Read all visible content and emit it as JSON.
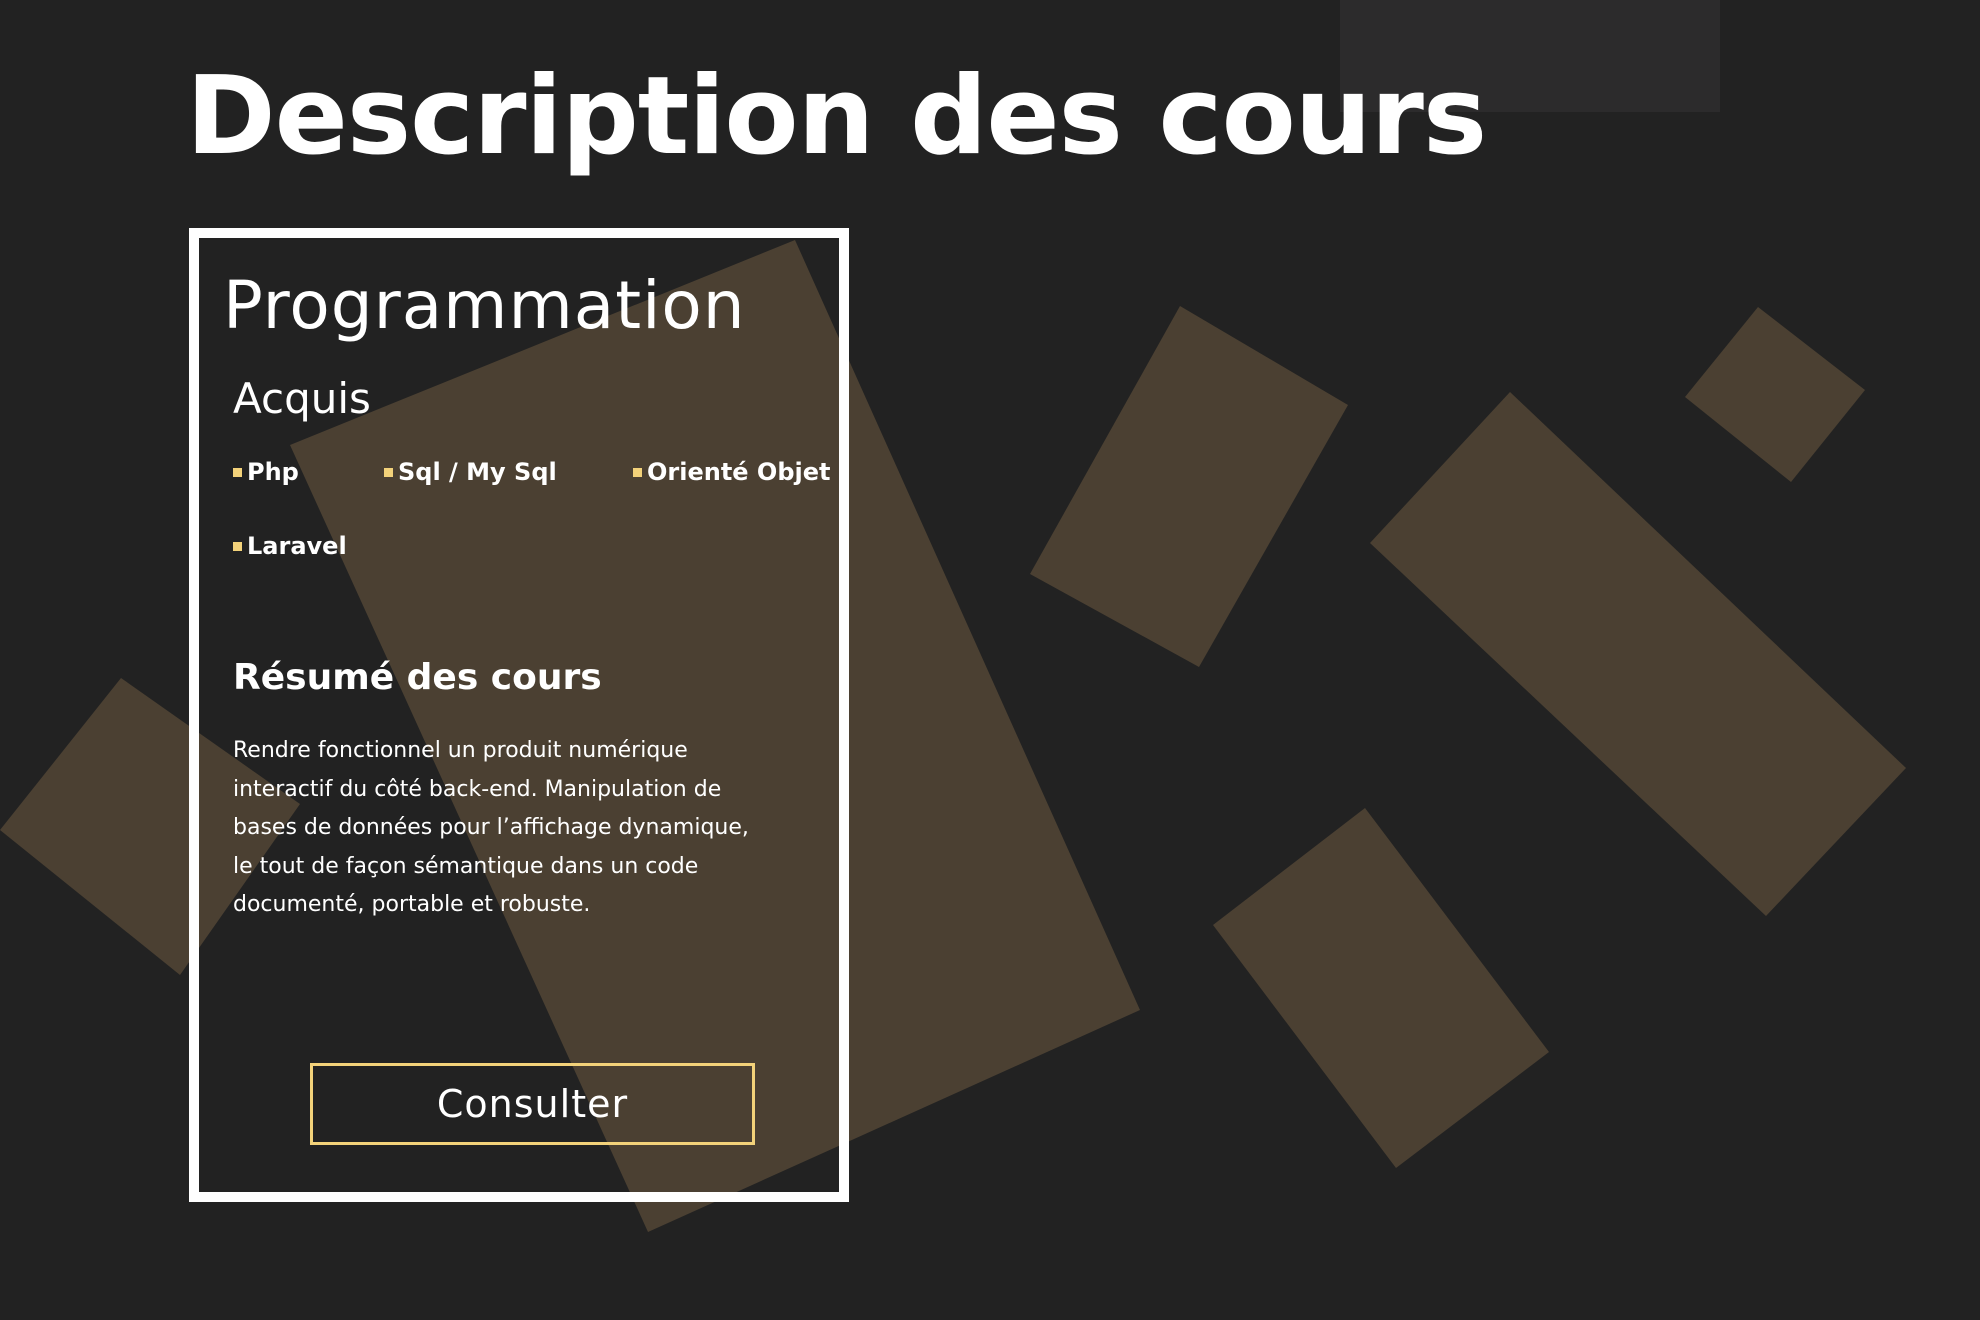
{
  "page": {
    "title": "Description des cours"
  },
  "card": {
    "title": "Programmation",
    "acquis_heading": "Acquis",
    "skills": [
      "Php",
      "Sql / My Sql",
      "Orienté Objet",
      "Laravel"
    ],
    "summary_heading": "Résumé des cours",
    "summary_text": "Rendre fonctionnel un produit numérique interactif du côté back-end. Manipulation de bases de données pour l’affichage dynamique, le tout de façon sémantique dans un code documenté, portable et robuste.",
    "button_label": "Consulter"
  },
  "colors": {
    "background": "#222222",
    "accent": "#f3d27a",
    "shape": "#4b4032",
    "block": "#2c2b2c",
    "text": "#ffffff"
  }
}
